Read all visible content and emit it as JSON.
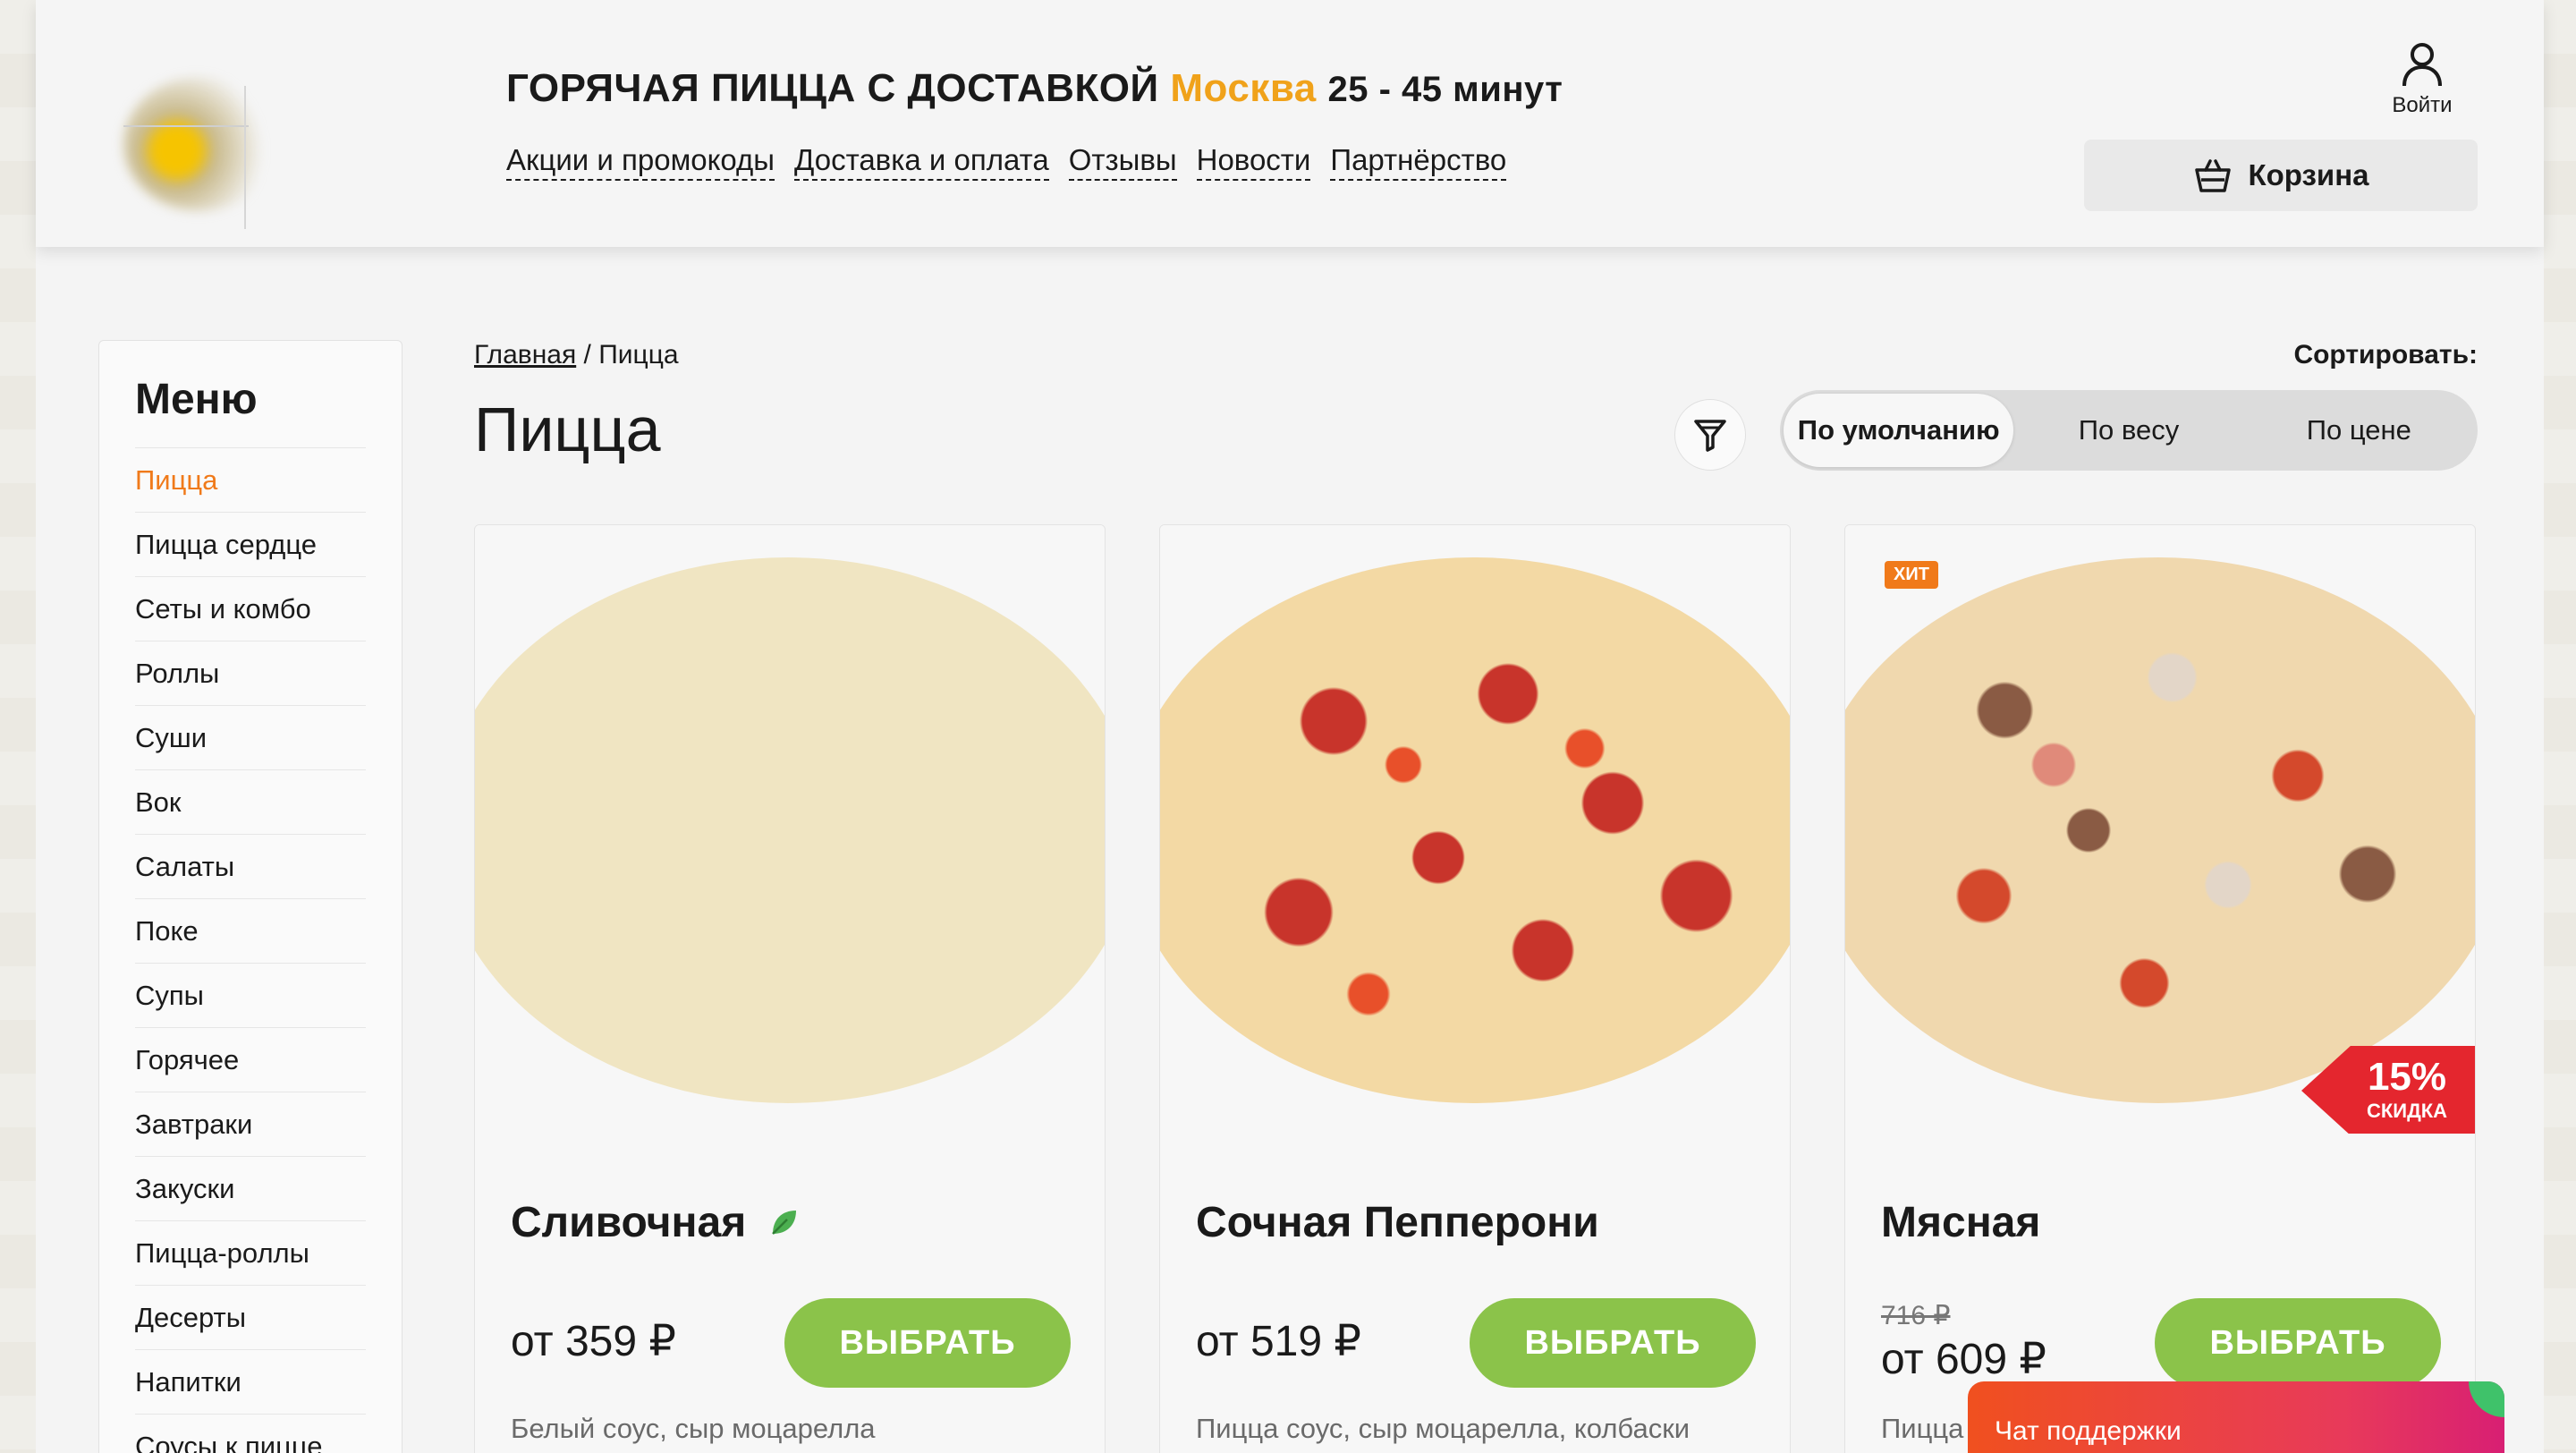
{
  "header": {
    "headline_main": "ГОРЯЧАЯ ПИЦЦА С ДОСТАВКОЙ",
    "city": "Москва",
    "delivery_time": "25 - 45 минут",
    "nav": [
      {
        "label": "Акции и промокоды"
      },
      {
        "label": "Доставка и оплата"
      },
      {
        "label": "Отзывы"
      },
      {
        "label": "Новости"
      },
      {
        "label": "Партнёрство"
      }
    ],
    "login_label": "Войти",
    "cart_label": "Корзина"
  },
  "sidebar": {
    "title": "Меню",
    "items": [
      {
        "label": "Пицца",
        "active": true
      },
      {
        "label": "Пицца сердце"
      },
      {
        "label": "Сеты и комбо"
      },
      {
        "label": "Роллы"
      },
      {
        "label": "Суши"
      },
      {
        "label": "Вок"
      },
      {
        "label": "Салаты"
      },
      {
        "label": "Поке"
      },
      {
        "label": "Супы"
      },
      {
        "label": "Горячее"
      },
      {
        "label": "Завтраки"
      },
      {
        "label": "Закуски"
      },
      {
        "label": "Пицца-роллы"
      },
      {
        "label": "Десерты"
      },
      {
        "label": "Напитки"
      },
      {
        "label": "Соусы к пицце"
      }
    ]
  },
  "main": {
    "breadcrumb": {
      "home": "Главная",
      "separator": "/",
      "current": "Пицца"
    },
    "title": "Пицца",
    "sort": {
      "label": "Сортировать:",
      "options": [
        {
          "label": "По умолчанию",
          "active": true
        },
        {
          "label": "По весу"
        },
        {
          "label": "По цене"
        }
      ]
    },
    "products": [
      {
        "name": "Сливочная",
        "price": "от 359 ₽",
        "button": "ВЫБРАТЬ",
        "description": "Белый соус, сыр моцарелла",
        "vegetarian_icon": "leaf-icon"
      },
      {
        "name": "Сочная Пепперони",
        "price": "от 519 ₽",
        "button": "ВЫБРАТЬ",
        "description": "Пицца соус, сыр моцарелла, колбаски"
      },
      {
        "name": "Мясная",
        "old_price": "716 ₽",
        "price": "от 609 ₽",
        "button": "ВЫБРАТЬ",
        "description": "Пицца",
        "badge": "ХИТ",
        "discount_percent": "15%",
        "discount_label": "СКИДКА"
      }
    ]
  },
  "chat": {
    "label": "Чат поддержки"
  },
  "colors": {
    "accent_orange": "#f0a21a",
    "active_menu": "#f07a1a",
    "button_green": "#8bc34a",
    "discount_red": "#e4262e"
  }
}
